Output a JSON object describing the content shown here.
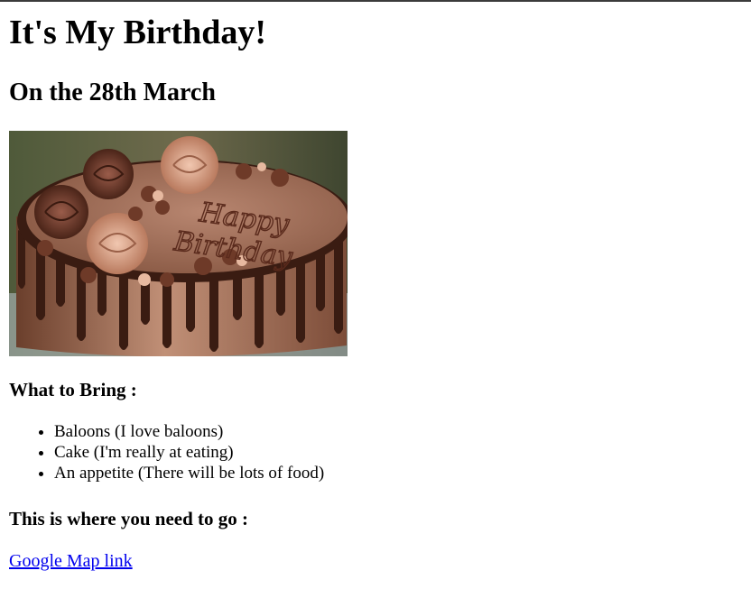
{
  "page": {
    "title": "It's My Birthday!",
    "date_heading": "On the 28th March"
  },
  "cake_image": {
    "alt": "Chocolate cake with Happy Birthday written on it",
    "inscription_line1": "Happy",
    "inscription_line2": "Birthday"
  },
  "bring_section": {
    "heading": "What to Bring :",
    "items": [
      "Baloons (I love baloons)",
      "Cake (I'm really at eating)",
      "An appetite (There will be lots of food)"
    ]
  },
  "location_section": {
    "heading": "This is where you need to go :",
    "link_label": "Google Map link"
  },
  "colors": {
    "link": "#0000ee",
    "text": "#000000",
    "background": "#ffffff"
  }
}
